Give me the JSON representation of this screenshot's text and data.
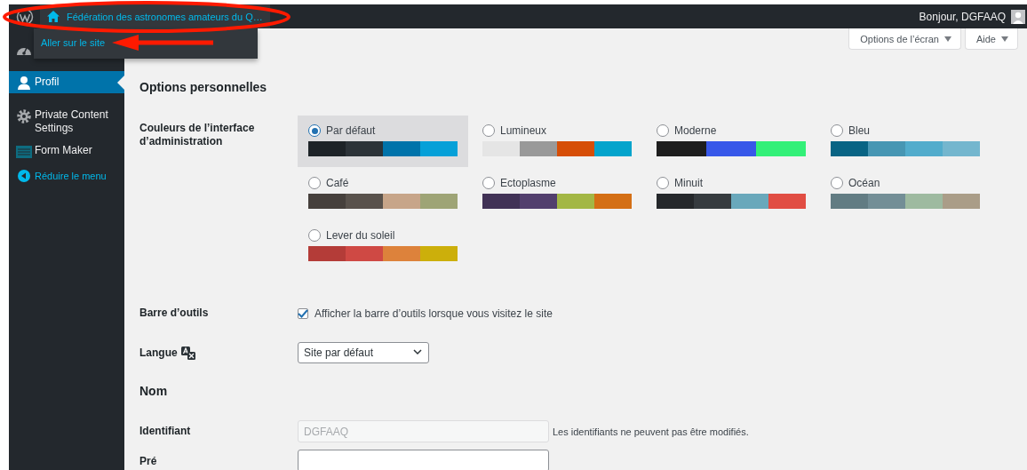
{
  "admin_bar": {
    "site_name": "Fédération des astronomes amateurs du Q…",
    "greeting": "Bonjour, DGFAAQ",
    "dropdown_items": [
      "Aller sur le site"
    ]
  },
  "sidebar": {
    "items": [
      {
        "selected": false
      },
      {
        "label": "Profil",
        "selected": true
      },
      {
        "label": "Private Content Settings",
        "selected": false
      },
      {
        "label": "Form Maker",
        "selected": false
      }
    ],
    "collapse_button": "Réduire le menu"
  },
  "screen_buttons": [
    "Options de l’écran",
    "Aide"
  ],
  "section_title": "Options personnelles",
  "color_scheme": {
    "label": "Couleurs de l’interface d’administration",
    "options": [
      {
        "name": "Par défaut",
        "selected": true,
        "swatches": [
          {
            "color": "#1d2327"
          },
          {
            "color": "#2c3338"
          },
          {
            "color": "#0073aa"
          },
          {
            "color": "#05a0d8"
          }
        ]
      },
      {
        "name": "Lumineux",
        "selected": false,
        "swatches": [
          {
            "color": "#e5e5e5"
          },
          {
            "color": "#999999"
          },
          {
            "color": "#d64e07"
          },
          {
            "color": "#04a4cc"
          }
        ]
      },
      {
        "name": "Moderne",
        "selected": false,
        "swatches": [
          {
            "color": "#1e1e1e"
          },
          {
            "color": "#3858e9"
          },
          {
            "color": "#33f078"
          }
        ]
      },
      {
        "name": "Bleu",
        "selected": false,
        "swatches": [
          {
            "color": "#096484"
          },
          {
            "color": "#4796b3"
          },
          {
            "color": "#52accc"
          },
          {
            "color": "#74b6ce"
          }
        ]
      },
      {
        "name": "Café",
        "selected": false,
        "swatches": [
          {
            "color": "#46403c"
          },
          {
            "color": "#59524c"
          },
          {
            "color": "#c7a589"
          },
          {
            "color": "#9ea476"
          }
        ]
      },
      {
        "name": "Ectoplasme",
        "selected": false,
        "swatches": [
          {
            "color": "#413256"
          },
          {
            "color": "#523f6d"
          },
          {
            "color": "#a3b745"
          },
          {
            "color": "#d46f15"
          }
        ]
      },
      {
        "name": "Minuit",
        "selected": false,
        "swatches": [
          {
            "color": "#25282b"
          },
          {
            "color": "#363b3f"
          },
          {
            "color": "#69a8bb"
          },
          {
            "color": "#e14d43"
          }
        ]
      },
      {
        "name": "Océan",
        "selected": false,
        "swatches": [
          {
            "color": "#627c83"
          },
          {
            "color": "#738e96"
          },
          {
            "color": "#9ebaa0"
          },
          {
            "color": "#aa9d88"
          }
        ]
      },
      {
        "name": "Lever du soleil",
        "selected": false,
        "swatches": [
          {
            "color": "#b43c38"
          },
          {
            "color": "#cf4944"
          },
          {
            "color": "#dd823b"
          },
          {
            "color": "#ccaf0b"
          }
        ]
      }
    ]
  },
  "toolbar": {
    "label": "Barre d’outils",
    "checkbox_label": "Afficher la barre d’outils lorsque vous visitez le site",
    "checked": true
  },
  "language": {
    "label": "Langue",
    "value": "Site par défaut"
  },
  "name_section": "Nom",
  "username": {
    "label": "Identifiant",
    "value": "DGFAAQ",
    "disabled": true,
    "note": "Les identifiants ne peuvent pas être modifiés."
  },
  "first_name": {
    "label": "Pré"
  }
}
